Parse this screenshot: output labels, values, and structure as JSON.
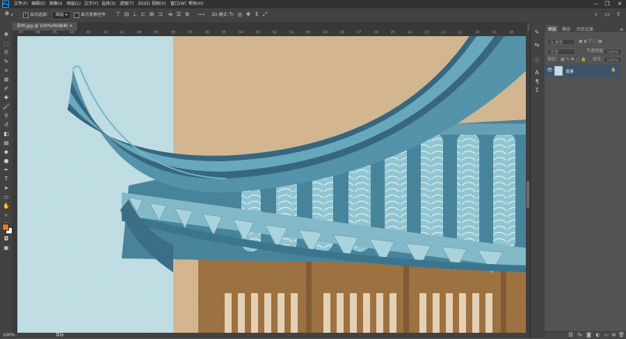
{
  "menu": [
    "文件(F)",
    "编辑(E)",
    "图像(I)",
    "图层(L)",
    "文字(Y)",
    "选择(S)",
    "滤镜(T)",
    "3D(D)",
    "视图(V)",
    "窗口(W)",
    "帮助(H)"
  ],
  "window_controls": {
    "minimize": "—",
    "restore": "❐",
    "close": "✕"
  },
  "options": {
    "tool_glyph": "✥",
    "auto_select_label": "自动选择：",
    "auto_select_target": "图层",
    "show_transform_label": "显示变换控件",
    "more": "•••",
    "mode_3d": "3D 模式："
  },
  "document": {
    "tab_label": "苏州.jpg @ 100%(RGB/8)",
    "close": "×"
  },
  "ruler_top_numbers": [
    "47",
    "46",
    "45",
    "44",
    "43",
    "42",
    "41",
    "40",
    "39",
    "38",
    "37",
    "36",
    "35",
    "34",
    "33",
    "32",
    "31",
    "30",
    "29",
    "28",
    "27",
    "26",
    "25",
    "24",
    "23",
    "22",
    "21",
    "20",
    "19",
    "18"
  ],
  "status": {
    "zoom": "100%",
    "info": "目标"
  },
  "layers_panel": {
    "tabs": [
      "图层",
      "路径",
      "历史记录"
    ],
    "kind_label": "Q 类型",
    "blend_mode": "正常",
    "opacity_label": "不透明度：",
    "opacity_value": "100%",
    "lock_label": "锁定：",
    "fill_label": "填充：",
    "fill_value": "100%",
    "layer_name": "背景"
  },
  "colors": {
    "foreground": "#e87722",
    "background": "#ffffff",
    "selected_layer": "#3e5369"
  }
}
